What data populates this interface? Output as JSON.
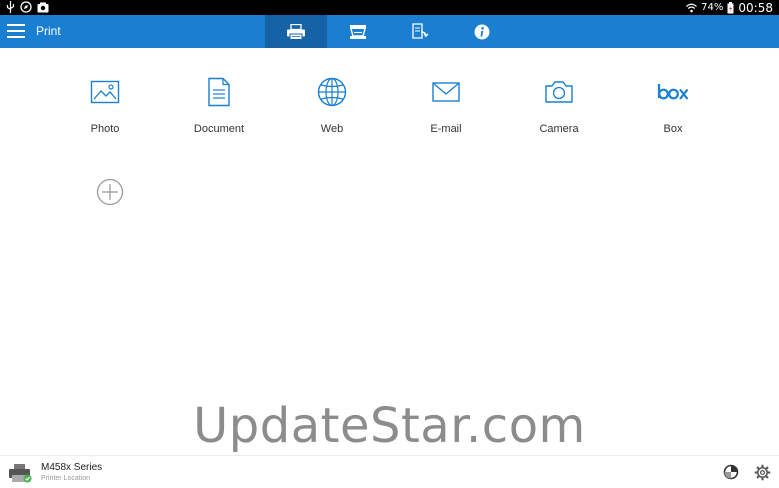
{
  "status_bar": {
    "battery": "74%",
    "time": "00:58",
    "icons": [
      "usb-icon",
      "compass-icon",
      "photo-notification-icon",
      "wifi-icon",
      "battery-icon"
    ]
  },
  "app_bar": {
    "title": "Print",
    "tabs": [
      {
        "name": "print",
        "icon": "printer-icon",
        "active": true
      },
      {
        "name": "scan",
        "icon": "scanner-icon",
        "active": false
      },
      {
        "name": "jobs",
        "icon": "document-arrow-icon",
        "active": false
      },
      {
        "name": "info",
        "icon": "info-icon",
        "active": false
      }
    ],
    "accent_color": "#1a7fd0",
    "active_tab_color": "#1563a6"
  },
  "sources": [
    {
      "label": "Photo",
      "icon": "photo-icon"
    },
    {
      "label": "Document",
      "icon": "document-icon"
    },
    {
      "label": "Web",
      "icon": "globe-icon"
    },
    {
      "label": "E-mail",
      "icon": "envelope-icon"
    },
    {
      "label": "Camera",
      "icon": "camera-icon"
    },
    {
      "label": "Box",
      "icon": "box-logo-icon"
    }
  ],
  "add_source": {
    "icon": "plus-circle-icon"
  },
  "watermark": "UpdateStar.com",
  "printer": {
    "name": "M458x Series",
    "location": "Printer Location",
    "status_color": "#4caf50"
  },
  "bottom_icons": [
    "ink-level-icon",
    "settings-icon"
  ]
}
